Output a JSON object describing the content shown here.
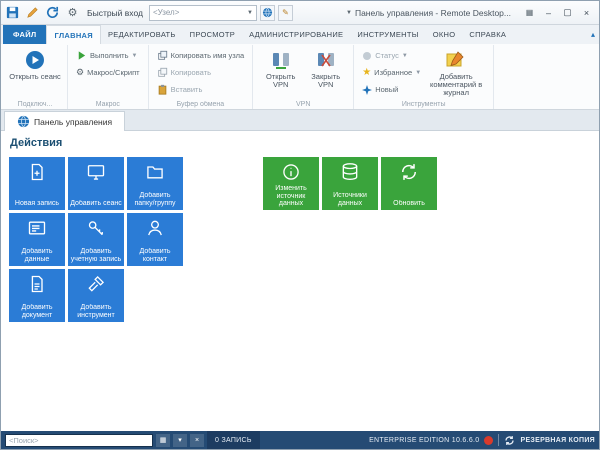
{
  "colors": {
    "accent_blue": "#2273b9",
    "tile_blue": "#2b7cd6",
    "tile_green": "#3aa43c",
    "statusbar_bg": "#254b74"
  },
  "titlebar": {
    "quick_connect_label": "Быстрый вход",
    "host_combo_value": "<Узел>",
    "window_title": "Панель управления - Remote Desktop...",
    "window_buttons": {
      "minimize": "–",
      "maximize": "▢",
      "close": "×"
    }
  },
  "ribbon_tabs": {
    "active": "ГЛАВНАЯ",
    "items": [
      {
        "label": "ФАЙЛ"
      },
      {
        "label": "ГЛАВНАЯ"
      },
      {
        "label": "РЕДАКТИРОВАТЬ"
      },
      {
        "label": "ПРОСМОТР"
      },
      {
        "label": "АДМИНИСТРИРОВАНИЕ"
      },
      {
        "label": "ИНСТРУМЕНТЫ"
      },
      {
        "label": "ОКНО"
      },
      {
        "label": "СПРАВКА"
      }
    ]
  },
  "ribbon": {
    "groups": [
      {
        "label": "Подключ...",
        "buttons": [
          {
            "label": "Открыть сеанс",
            "icon": "open-session-play-icon"
          }
        ]
      },
      {
        "label": "Макрос",
        "buttons": [
          {
            "label": "Выполнить",
            "icon": "run-icon",
            "dropdown": true
          },
          {
            "label": "Макрос/Скрипт",
            "icon": "script-gear-icon"
          }
        ]
      },
      {
        "label": "Буфер обмена",
        "buttons": [
          {
            "label": "Копировать имя узла",
            "icon": "copy-name-icon"
          },
          {
            "label": "Копировать",
            "icon": "copy-icon"
          },
          {
            "label": "Вставить",
            "icon": "paste-icon"
          }
        ]
      },
      {
        "label": "VPN",
        "buttons": [
          {
            "label": "Открыть VPN",
            "icon": "vpn-open-icon"
          },
          {
            "label": "Закрыть VPN",
            "icon": "vpn-close-icon"
          }
        ]
      },
      {
        "label": "Инструменты",
        "buttons": [
          {
            "label": "Статус",
            "icon": "status-icon",
            "dropdown": true
          },
          {
            "label": "Избранное",
            "icon": "favorite-star-icon",
            "dropdown": true
          },
          {
            "label": "Новый",
            "icon": "new-sparkle-icon"
          },
          {
            "label": "Добавить комментарий в журнал",
            "icon": "journal-comment-icon"
          }
        ]
      }
    ]
  },
  "document_tabs": {
    "active_tab": {
      "label": "Панель управления",
      "icon": "dashboard-globe-icon"
    }
  },
  "dashboard": {
    "heading": "Действия",
    "tiles": [
      {
        "label": "Новая запись",
        "icon": "new-entry-icon",
        "color": "blue"
      },
      {
        "label": "Добавить сеанс",
        "icon": "monitor-icon",
        "color": "blue"
      },
      {
        "label": "Добавить папку/группу",
        "icon": "folder-icon",
        "color": "blue"
      },
      {
        "label": "Добавить данные",
        "icon": "data-card-icon",
        "color": "blue"
      },
      {
        "label": "Добавить учетную запись",
        "icon": "key-icon",
        "color": "blue"
      },
      {
        "label": "Добавить контакт",
        "icon": "contact-icon",
        "color": "blue"
      },
      {
        "label": "Добавить документ",
        "icon": "document-icon",
        "color": "blue"
      },
      {
        "label": "Добавить инструмент",
        "icon": "tools-icon",
        "color": "blue"
      },
      {
        "label": "Изменить источник данных",
        "icon": "info-icon",
        "color": "green"
      },
      {
        "label": "Источники данных",
        "icon": "database-icon",
        "color": "green"
      },
      {
        "label": "Обновить",
        "icon": "refresh-icon",
        "color": "green"
      }
    ]
  },
  "statusbar": {
    "search_placeholder": "<Поиск>",
    "record_count": "0 ЗАПИСЬ",
    "edition": "ENTERPRISE EDITION 10.6.6.0",
    "backup_label": "РЕЗЕРВНАЯ КОПИЯ"
  }
}
